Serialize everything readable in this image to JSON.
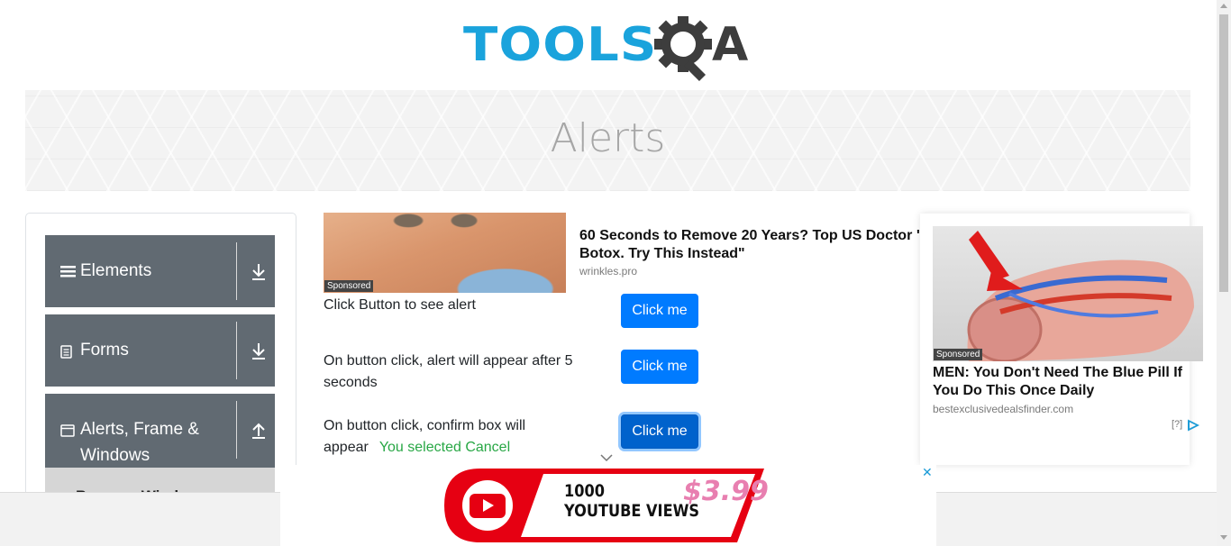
{
  "logo": {
    "part1": "TOOLS",
    "part2": "A",
    "colors": {
      "tools": "#1aa3dc",
      "qa": "#3d3d3d"
    }
  },
  "banner": {
    "title": "Alerts"
  },
  "sidebar": {
    "groups": [
      {
        "label": "Elements",
        "icon": "hamburger-icon",
        "arrow": "download-icon"
      },
      {
        "label": "Forms",
        "icon": "document-icon",
        "arrow": "download-icon"
      },
      {
        "label": "Alerts, Frame &",
        "label2": "Windows",
        "icon": "window-icon",
        "arrow": "upload-icon"
      }
    ],
    "subitem": {
      "label": "Browser Windows"
    }
  },
  "ad_top": {
    "sponsored": "Sponsored",
    "title": "60 Seconds to Remove 20 Years? Top US Doctor \"",
    "title2": "Botox. Try This Instead\"",
    "domain": "wrinkles.pro"
  },
  "rows": [
    {
      "text": "Click Button to see alert",
      "button": "Click me"
    },
    {
      "text": "On button click, alert will appear after 5 seconds",
      "button": "Click me"
    },
    {
      "text": "On button click, confirm box will appear",
      "result": "You selected Cancel",
      "button": "Click me"
    }
  ],
  "ad_right": {
    "sponsored": "Sponsored",
    "title": "MEN: You Don't Need The Blue Pill If You Do This Once Daily",
    "domain": "bestexclusivedealsfinder.com",
    "info": "[?]"
  },
  "ad_bottom": {
    "line1": "1000",
    "line2": "YOUTUBE VIEWS",
    "price": "$3.99",
    "close": "✕"
  },
  "colors": {
    "primary": "#007bff",
    "sidebar": "#616a72",
    "success": "#28a745"
  }
}
